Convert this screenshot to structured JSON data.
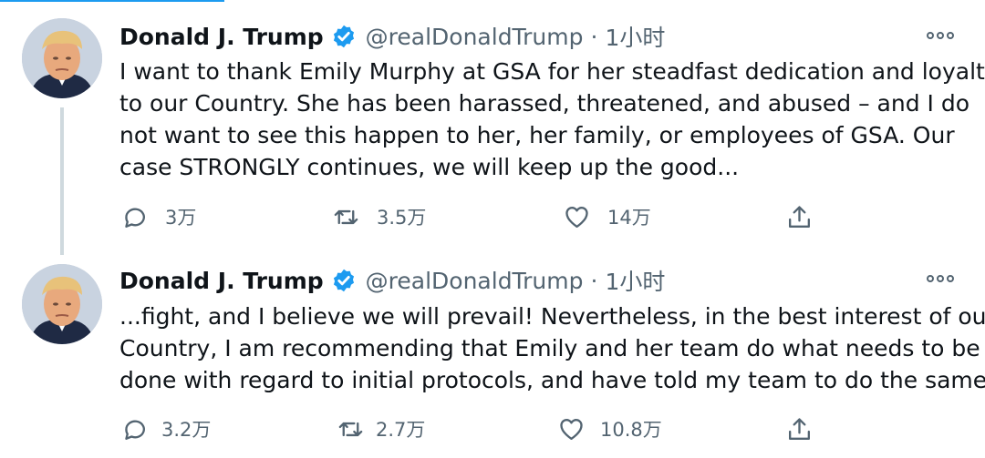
{
  "colors": {
    "accent": "#1d9bf0",
    "text": "#0f1419",
    "muted": "#536471",
    "thread_line": "#cfd9de"
  },
  "tweets": [
    {
      "author_name": "Donald J. Trump",
      "verified_icon": "verified-badge-icon",
      "handle": "@realDonaldTrump",
      "separator": "·",
      "time": "1小时",
      "text_lines": [
        "I want to thank Emily Murphy at GSA for her steadfast dedication and loyalty",
        "to our Country. She has been harassed, threatened, and abused – and I do",
        "not want to see this happen to her, her family, or employees of GSA. Our",
        "case STRONGLY continues, we will keep up the good..."
      ],
      "replies": "3万",
      "retweets": "3.5万",
      "likes": "14万"
    },
    {
      "author_name": "Donald J. Trump",
      "verified_icon": "verified-badge-icon",
      "handle": "@realDonaldTrump",
      "separator": "·",
      "time": "1小时",
      "text_lines": [
        "...fight, and I believe we will prevail! Nevertheless, in the best interest of our",
        "Country, I am recommending that Emily and her team do what needs to be",
        "done with regard to initial protocols, and have told my team to do the same."
      ],
      "replies": "3.2万",
      "retweets": "2.7万",
      "likes": "10.8万"
    }
  ]
}
